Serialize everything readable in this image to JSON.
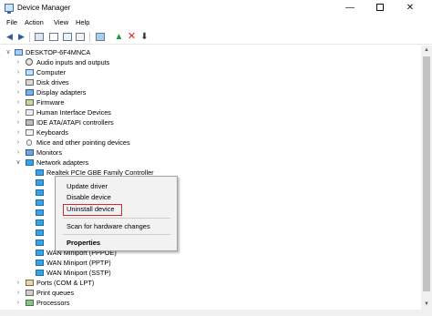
{
  "window": {
    "title": "Device Manager",
    "controls": {
      "minimize": "—",
      "close": "✕"
    }
  },
  "menubar": [
    "File",
    "Action",
    "View",
    "Help"
  ],
  "toolbar": {
    "icons": [
      "back-arrow-icon",
      "forward-arrow-icon",
      "properties-icon",
      "show-hidden-icon",
      "help-icon",
      "scan-hardware-icon",
      "update-driver-icon",
      "uninstall-icon",
      "disable-icon"
    ]
  },
  "tree": {
    "root": "DESKTOP-6F4MNCA",
    "items": [
      {
        "label": "Audio inputs and outputs",
        "icon": "audio-icon"
      },
      {
        "label": "Computer",
        "icon": "computer-icon"
      },
      {
        "label": "Disk drives",
        "icon": "disk-icon"
      },
      {
        "label": "Display adapters",
        "icon": "display-icon"
      },
      {
        "label": "Firmware",
        "icon": "firmware-icon"
      },
      {
        "label": "Human Interface Devices",
        "icon": "hid-icon"
      },
      {
        "label": "IDE ATA/ATAPI controllers",
        "icon": "ide-icon"
      },
      {
        "label": "Keyboards",
        "icon": "keyboard-icon"
      },
      {
        "label": "Mice and other pointing devices",
        "icon": "mouse-icon"
      },
      {
        "label": "Monitors",
        "icon": "monitor-icon"
      },
      {
        "label": "Network adapters",
        "icon": "network-icon"
      }
    ],
    "network_children": [
      "Realtek PCIe GBE Family Controller",
      "",
      "",
      "",
      "",
      "",
      "",
      "",
      "WAN Miniport (PPPOE)",
      "WAN Miniport (PPTP)",
      "WAN Miniport (SSTP)"
    ],
    "after": [
      {
        "label": "Ports (COM & LPT)",
        "icon": "ports-icon"
      },
      {
        "label": "Print queues",
        "icon": "printer-icon"
      },
      {
        "label": "Processors",
        "icon": "processor-icon"
      }
    ]
  },
  "context_menu": {
    "update_driver": "Update driver",
    "disable_device": "Disable device",
    "uninstall_device": "Uninstall device",
    "scan_hardware": "Scan for hardware changes",
    "properties": "Properties"
  },
  "colors": {
    "highlight_border": "#d12b2b",
    "menu_bg": "#f2f2f2"
  }
}
